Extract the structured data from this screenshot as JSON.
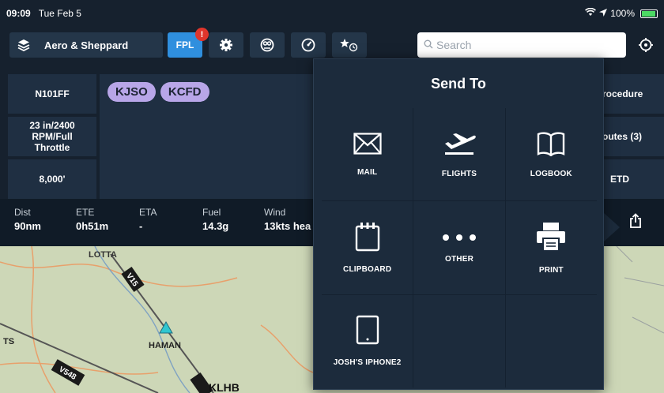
{
  "status": {
    "time": "09:09",
    "date": "Tue Feb 5",
    "battery": "100%"
  },
  "toolbar": {
    "layers_label": "Aero & Sheppard",
    "fpl_label": "FPL",
    "fpl_badge": "!",
    "search_placeholder": "Search",
    "icons": [
      "layers-icon",
      "gear-icon",
      "scissors-icon",
      "gauge-icon",
      "star-clock-icon",
      "locate-icon"
    ]
  },
  "flight_plan": {
    "aircraft": "N101FF",
    "power_setting": "23 in/2400 RPM/Full Throttle",
    "altitude": "8,000'",
    "waypoints": [
      "KJSO",
      "KCFD"
    ],
    "right_items": [
      "rocedure",
      "outes (3)",
      "ETD"
    ]
  },
  "stats": [
    {
      "label": "Dist",
      "value": "90nm"
    },
    {
      "label": "ETE",
      "value": "0h51m"
    },
    {
      "label": "ETA",
      "value": "-"
    },
    {
      "label": "Fuel",
      "value": "14.3g"
    },
    {
      "label": "Wind",
      "value": "13kts hea"
    }
  ],
  "map": {
    "labels": [
      "LOTTA",
      "V15",
      "HAMAN",
      "TS",
      "V548",
      "KLHB"
    ]
  },
  "send_to": {
    "title": "Send To",
    "items": [
      {
        "label": "MAIL",
        "icon": "mail-icon"
      },
      {
        "label": "FLIGHTS",
        "icon": "airplane-takeoff-icon"
      },
      {
        "label": "LOGBOOK",
        "icon": "book-icon"
      },
      {
        "label": "CLIPBOARD",
        "icon": "clipboard-icon"
      },
      {
        "label": "OTHER",
        "icon": "more-dots-icon"
      },
      {
        "label": "PRINT",
        "icon": "printer-icon"
      },
      {
        "label": "JOSH'S IPHONE2",
        "icon": "tablet-icon"
      }
    ]
  }
}
